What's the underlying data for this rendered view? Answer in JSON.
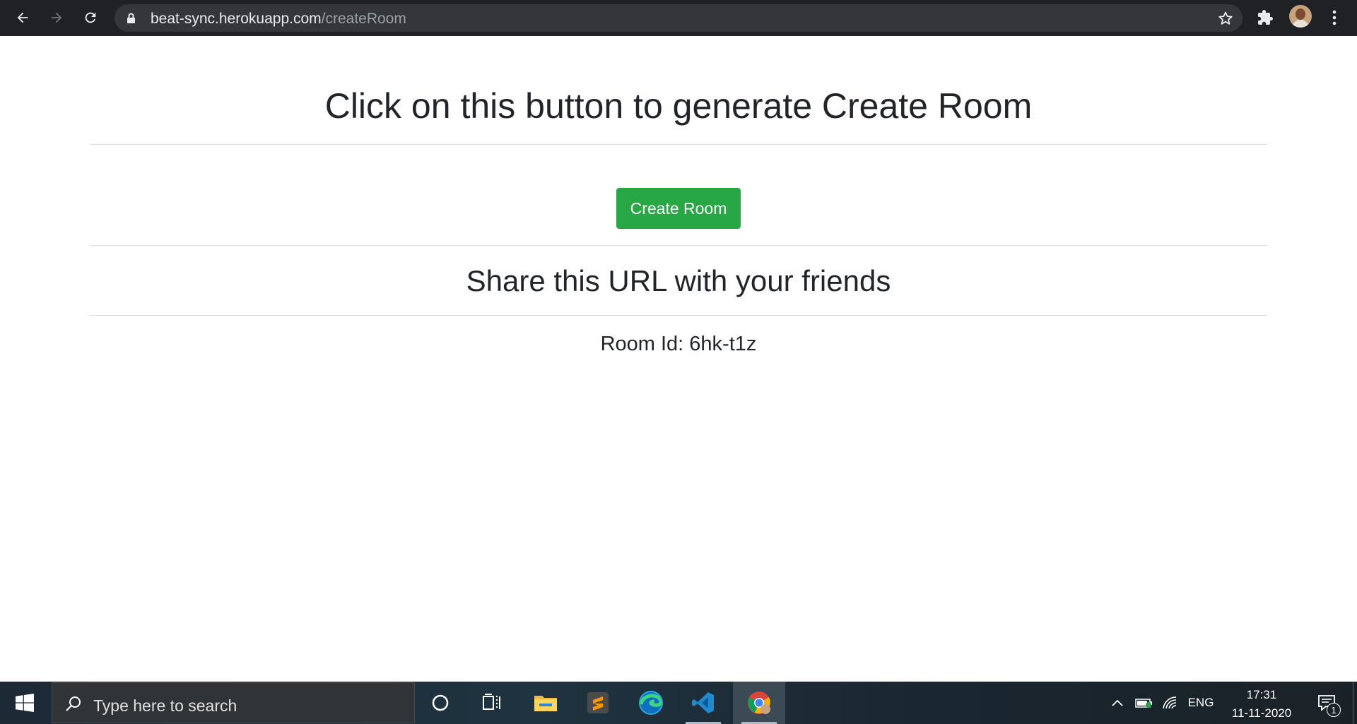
{
  "browser": {
    "url_host": "beat-sync.herokuapp.com",
    "url_path": "/createRoom",
    "icons": [
      "back-icon",
      "forward-icon",
      "reload-icon",
      "lock-icon",
      "star-icon",
      "extensions-icon",
      "profile-avatar",
      "menu-dots-icon"
    ]
  },
  "page": {
    "heading": "Click on this button to generate Create Room",
    "create_button_label": "Create Room",
    "share_heading": "Share this URL with your friends",
    "room_id_text": "Room Id: 6hk-t1z",
    "colors": {
      "button": "#28a745",
      "text": "#212529",
      "divider": "#dcdcdc"
    }
  },
  "taskbar": {
    "search_placeholder": "Type here to search",
    "apps": [
      "cortana-icon",
      "task-view-icon",
      "file-explorer-icon",
      "sublime-text-icon",
      "edge-icon",
      "vscode-icon",
      "chrome-icon"
    ],
    "tray": {
      "language": "ENG",
      "time": "17:31",
      "date": "11-11-2020",
      "notification_count": "1"
    }
  }
}
